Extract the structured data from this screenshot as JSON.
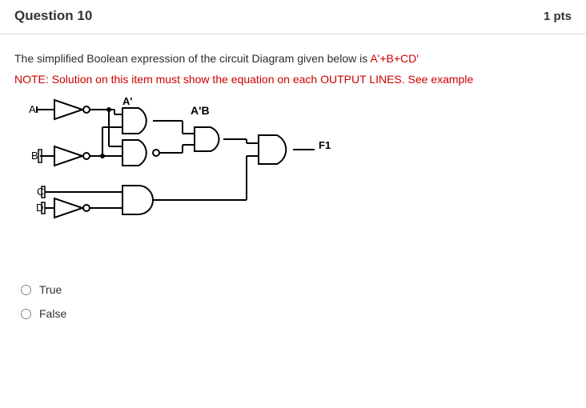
{
  "header": {
    "title": "Question 10",
    "points": "1 pts"
  },
  "question": {
    "stem_prefix": "The simplified Boolean expression of the circuit Diagram given below is ",
    "stem_expr": "A'+B+CD'",
    "note": "NOTE: Solution on this item must show the equation on each OUTPUT LINES. See example"
  },
  "diagram": {
    "inputs": [
      "A",
      "B",
      "C",
      "D"
    ],
    "labels": {
      "Aprime": "A'",
      "AprimeB": "A'B",
      "output": "F1"
    }
  },
  "options": {
    "opt1": "True",
    "opt2": "False"
  }
}
